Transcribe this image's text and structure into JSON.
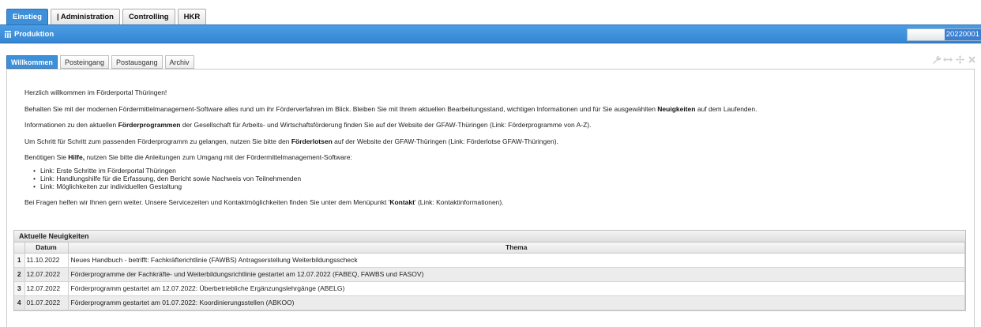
{
  "top_tabs": [
    {
      "label": "Einstieg",
      "active": true
    },
    {
      "label": "| Administration",
      "active": false
    },
    {
      "label": "Controlling",
      "active": false
    },
    {
      "label": "HKR",
      "active": false
    }
  ],
  "production_bar": {
    "icon": "list-icon",
    "title": "Produktion",
    "field_value": "20220001"
  },
  "sub_tabs": [
    {
      "label": "Willkommen",
      "active": true
    },
    {
      "label": "Posteingang",
      "active": false
    },
    {
      "label": "Postausgang",
      "active": false
    },
    {
      "label": "Archiv",
      "active": false
    }
  ],
  "window_tools": [
    "wrench-icon",
    "resize-horizontal-icon",
    "move-icon",
    "close-icon"
  ],
  "welcome": {
    "greeting": "Herzlich willkommen im Förderportal Thüringen!",
    "p1_a": "Behalten Sie mit der modernen Fördermittelmanagement-Software alles rund um ihr Förderverfahren im Blick. Bleiben Sie mit Ihrem aktuellen Bearbeitungsstand, wichtigen Informationen und für Sie ausgewählten ",
    "p1_b": "Neuigkeiten",
    "p1_c": " auf dem Laufenden.",
    "p2_a": "Informationen zu den aktuellen ",
    "p2_b": "Förderprogrammen",
    "p2_c": " der Gesellschaft für Arbeits- und Wirtschaftsförderung finden Sie auf der Website der GFAW-Thüringen (Link: Förderprogramme von A-Z).",
    "p3_a": "Um Schritt für Schritt zum passenden Förderprogramm zu gelangen, nutzen Sie bitte den ",
    "p3_b": "Förderlotsen",
    "p3_c": " auf der Website der GFAW-Thüringen (Link: Förderlotse GFAW-Thüringen).",
    "p4_a": "Benötigen Sie ",
    "p4_b": "Hilfe,",
    "p4_c": " nutzen Sie bitte die Anleitungen zum Umgang mit der Fördermittelmanagement-Software:",
    "links": [
      "Link: Erste Schritte im Förderportal Thüringen",
      "Link: Handlungshilfe für die Erfassung, den Bericht sowie Nachweis von Teilnehmenden",
      "Link: Möglichkeiten zur individuellen Gestaltung"
    ],
    "p5_a": "Bei Fragen helfen wir Ihnen gern weiter. Unsere Servicezeiten und Kontaktmöglichkeiten finden Sie unter dem Menüpunkt '",
    "p5_b": "Kontakt",
    "p5_c": "' (Link: Kontaktinformationen)."
  },
  "news": {
    "title": "Aktuelle Neuigkeiten",
    "columns": [
      "Datum",
      "Thema"
    ],
    "rows": [
      {
        "num": "1",
        "date": "11.10.2022",
        "topic": "Neues Handbuch - betrifft: Fachkräfterichtlinie (FAWBS) Antragserstellung Weiterbildungsscheck"
      },
      {
        "num": "2",
        "date": "12.07.2022",
        "topic": "Förderprogramme der Fachkräfte- und Weiterbildungsrichtlinie gestartet am 12.07.2022 (FABEQ, FAWBS und FASOV)"
      },
      {
        "num": "3",
        "date": "12.07.2022",
        "topic": "Förderprogramm gestartet am 12.07.2022: Überbetriebliche Ergänzungslehrgänge (ABELG)"
      },
      {
        "num": "4",
        "date": "01.07.2022",
        "topic": "Förderprogramm gestartet am 01.07.2022: Koordinierungsstellen (ABKOO)"
      }
    ]
  }
}
